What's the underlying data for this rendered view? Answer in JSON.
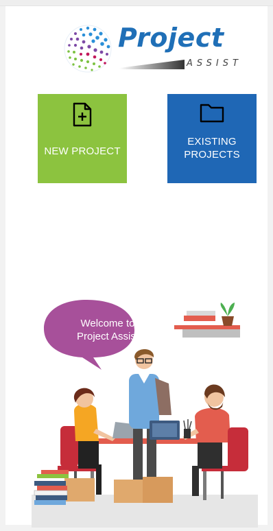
{
  "logo": {
    "word": "Project",
    "sub": "ASSIST"
  },
  "tiles": {
    "new_project": {
      "label": "NEW PROJECT",
      "icon": "file-plus-icon",
      "color": "#8cc33f"
    },
    "existing_projects": {
      "label": "EXISTING\nPROJECTS",
      "icon": "folder-icon",
      "color": "#1f67b5"
    }
  },
  "illustration": {
    "bubble_text": "Welcome to\nProject Assist",
    "bubble_color": "#a7509a"
  }
}
